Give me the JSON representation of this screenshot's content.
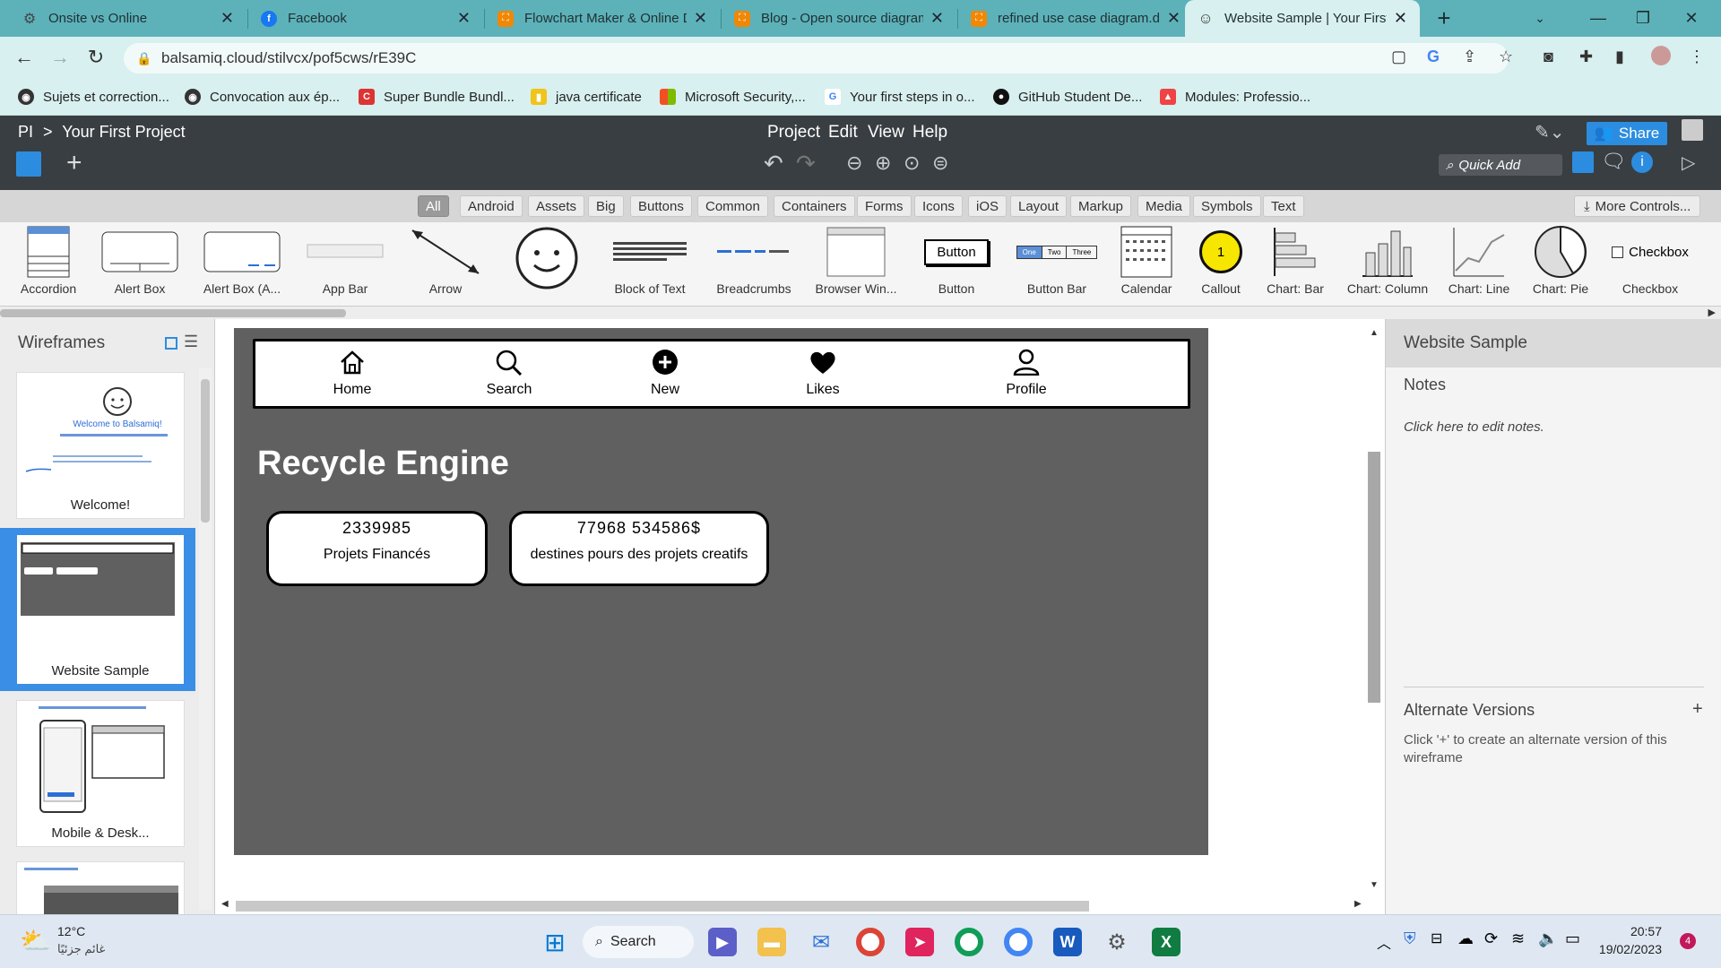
{
  "browser": {
    "tabs": [
      {
        "title": "Onsite vs Online",
        "icon": "gear-globe-icon"
      },
      {
        "title": "Facebook",
        "icon": "facebook-icon"
      },
      {
        "title": "Flowchart Maker & Online D",
        "icon": "drawio-icon"
      },
      {
        "title": "Blog - Open source diagram",
        "icon": "drawio-icon"
      },
      {
        "title": "refined use case diagram.d",
        "icon": "drawio-icon"
      },
      {
        "title": "Website Sample | Your First",
        "icon": "balsamiq-icon"
      }
    ],
    "url": "balsamiq.cloud/stilvcx/pof5cws/rE39C",
    "bookmarks": [
      "Sujets et correction...",
      "Convocation aux ép...",
      "Super Bundle Bundl...",
      "java certificate",
      "Microsoft Security,...",
      "Your first steps in o...",
      "GitHub Student De...",
      "Modules: Professio..."
    ]
  },
  "app": {
    "breadcrumb_root": "PI",
    "breadcrumb_sep": ">",
    "project_name": "Your First Project",
    "menu": [
      "Project",
      "Edit",
      "View",
      "Help"
    ],
    "share_label": "Share",
    "quick_add_placeholder": "Quick Add",
    "filters": [
      "All",
      "Android",
      "Assets",
      "Big",
      "Buttons",
      "Common",
      "Containers",
      "Forms",
      "Icons",
      "iOS",
      "Layout",
      "Markup",
      "Media",
      "Symbols",
      "Text"
    ],
    "active_filter": "All",
    "more_controls": "More Controls...",
    "components": [
      "Accordion",
      "Alert Box",
      "Alert Box (A...",
      "App Bar",
      "Arrow",
      "",
      "Block of Text",
      "Breadcrumbs",
      "Browser Win...",
      "Button",
      "Button Bar",
      "Calendar",
      "Callout",
      "Chart: Bar",
      "Chart: Column",
      "Chart: Line",
      "Chart: Pie",
      "Checkbox"
    ],
    "button_sample": "Button",
    "button_bar_sample": [
      "One",
      "Two",
      "Three"
    ],
    "callout_sample": "1",
    "checkbox_sample": "Checkbox"
  },
  "left_panel": {
    "title": "Wireframes",
    "items": [
      "Welcome!",
      "Website Sample",
      "Mobile & Desk..."
    ],
    "selected": "Website Sample",
    "thumb_welcome_title": "Welcome to Balsamiq!"
  },
  "wireframe": {
    "nav": [
      "Home",
      "Search",
      "New",
      "Likes",
      "Profile"
    ],
    "title": "Recycle Engine",
    "stats": [
      {
        "value": "2339985",
        "label": "Projets Financés"
      },
      {
        "value": "77968 534586$",
        "label": "destines pours des projets creatifs"
      }
    ]
  },
  "right_panel": {
    "title": "Website Sample",
    "notes_heading": "Notes",
    "notes_placeholder": "Click here to edit notes.",
    "alt_heading": "Alternate Versions",
    "alt_add": "+",
    "alt_hint": "Click '+' to create an alternate version of this wireframe"
  },
  "taskbar": {
    "weather_temp": "12°C",
    "weather_desc": "غائم جزئيًا",
    "search_label": "Search",
    "time": "20:57",
    "date": "19/02/2023",
    "notification_count": "4"
  }
}
